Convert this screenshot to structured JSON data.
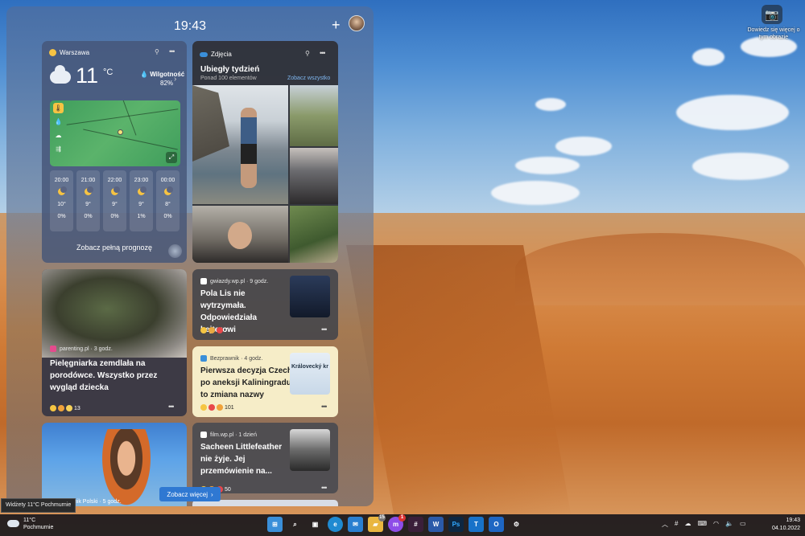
{
  "desktop": {
    "camera_tooltip": "Dowiedz się więcej o tym obrazie"
  },
  "panel": {
    "time": "19:43",
    "add_label": "+"
  },
  "weather": {
    "city": "Warszawa",
    "temperature": "11",
    "unit": "°C",
    "humidity_label": "Wilgotność",
    "humidity_value": "82%",
    "hours": [
      {
        "time": "20:00",
        "temp": "10°",
        "precip": "0%"
      },
      {
        "time": "21:00",
        "temp": "9°",
        "precip": "0%"
      },
      {
        "time": "22:00",
        "temp": "9°",
        "precip": "0%"
      },
      {
        "time": "23:00",
        "temp": "9°",
        "precip": "1%"
      },
      {
        "time": "00:00",
        "temp": "8°",
        "precip": "0%"
      }
    ],
    "footer": "Zobacz pełną prognozę"
  },
  "photos": {
    "app": "Zdjęcia",
    "title": "Ubiegły tydzień",
    "subtitle": "Ponad 100 elementów",
    "see_all": "Zobacz wszystko"
  },
  "news": [
    {
      "source": "parenting.pl · 3 godz.",
      "headline": "Pielęgniarka zemdlała na porodówce. Wszystko przez wygląd dziecka",
      "reactions": "13"
    },
    {
      "source": "gwiazdy.wp.pl · 9 godz.",
      "headline": "Pola Lis nie wytrzymała. Odpowiedziała hejterowi",
      "reactions": "7"
    },
    {
      "source": "Bezprawnik · 4 godz.",
      "headline": "Pierwsza decyzja Czech po aneksji Kaliningradu to zmiana nazwy",
      "reactions": "101",
      "thumb_text": "Královecký kr"
    },
    {
      "source": "Dziennik Polski · 5 godz."
    },
    {
      "source": "film.wp.pl · 1 dzień",
      "headline": "Sacheen Littlefeather nie żyje. Jej przemówienie na...",
      "reactions": "50"
    }
  ],
  "see_more": "Zobacz więcej",
  "tooltip": "Widżety 11°C Pochmurnie",
  "taskbar": {
    "weather_temp": "11°C",
    "weather_desc": "Pochmurnie",
    "apps": [
      {
        "name": "start",
        "label": "⊞",
        "color": "#3a8fd9"
      },
      {
        "name": "search",
        "label": "⌕",
        "color": "transparent"
      },
      {
        "name": "task-view",
        "label": "▣",
        "color": "transparent"
      },
      {
        "name": "edge",
        "label": "e",
        "color": "#1f8ad1"
      },
      {
        "name": "mail",
        "label": "✉",
        "color": "#2a7fd0"
      },
      {
        "name": "explorer",
        "label": "▰",
        "color": "#e9b640"
      },
      {
        "name": "messenger",
        "label": "m",
        "color": "#8e4de8",
        "badge": "1"
      },
      {
        "name": "slack",
        "label": "#",
        "color": "#3b1f3a"
      },
      {
        "name": "word",
        "label": "W",
        "color": "#2b5aa9"
      },
      {
        "name": "photoshop",
        "label": "Ps",
        "color": "#0d2742"
      },
      {
        "name": "trello",
        "label": "T",
        "color": "#1872c9"
      },
      {
        "name": "outlook",
        "label": "O",
        "color": "#1e66c3"
      },
      {
        "name": "settings",
        "label": "⚙",
        "color": "transparent"
      }
    ],
    "explorer_badge": "15",
    "time": "19:43",
    "date": "04.10.2022"
  }
}
